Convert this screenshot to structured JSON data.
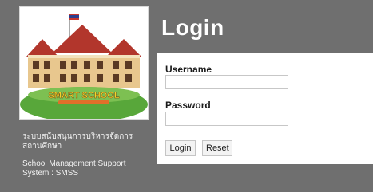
{
  "login": {
    "title": "Login",
    "username_label": "Username",
    "password_label": "Password",
    "username_value": "",
    "password_value": "",
    "login_button": "Login",
    "reset_button": "Reset"
  },
  "branding": {
    "description_th": "ระบบสนับสนุนการบริหารจัดการ สถานศึกษา",
    "description_en": "School Management Support System : SMSS",
    "logo_icon": "smart-school-logo"
  },
  "colors": {
    "background": "#6f6f6f",
    "panel": "#ffffff",
    "title": "#ffffff"
  }
}
